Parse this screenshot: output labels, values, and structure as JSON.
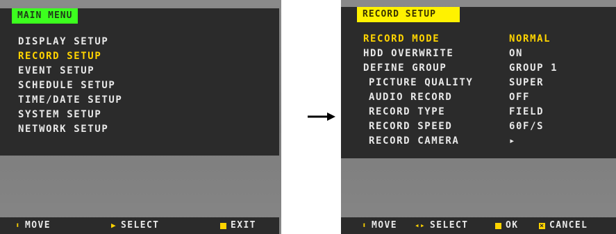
{
  "main_menu": {
    "title": "MAIN MENU",
    "items": [
      {
        "label": "DISPLAY SETUP",
        "active": false
      },
      {
        "label": "RECORD SETUP",
        "active": true
      },
      {
        "label": "EVENT SETUP",
        "active": false
      },
      {
        "label": "SCHEDULE SETUP",
        "active": false
      },
      {
        "label": "TIME/DATE SETUP",
        "active": false
      },
      {
        "label": "SYSTEM SETUP",
        "active": false
      },
      {
        "label": "NETWORK SETUP",
        "active": false
      }
    ],
    "footer": {
      "move": "MOVE",
      "select": "SELECT",
      "exit": "EXIT"
    }
  },
  "record_setup": {
    "title": "RECORD SETUP",
    "rows": [
      {
        "label": "RECORD MODE",
        "value": "NORMAL",
        "active": true
      },
      {
        "label": "HDD OVERWRITE",
        "value": "ON"
      },
      {
        "label": "DEFINE GROUP",
        "value": "GROUP 1"
      },
      {
        "label": "PICTURE QUALITY",
        "value": "SUPER"
      },
      {
        "label": "AUDIO RECORD",
        "value": "OFF"
      },
      {
        "label": "RECORD TYPE",
        "value": "FIELD"
      },
      {
        "label": "RECORD SPEED",
        "value": "60F/S"
      },
      {
        "label": "RECORD CAMERA",
        "value": "▸"
      }
    ],
    "footer": {
      "move": "MOVE",
      "select": "SELECT",
      "ok": "OK",
      "cancel": "CANCEL"
    }
  },
  "colors": {
    "menu_bg": "#2b2b2b",
    "main_title_bg": "#3cff1e",
    "record_title_bg": "#fff200",
    "highlight_text": "#ffd400",
    "normal_text": "#e8e8e8"
  },
  "icons": {
    "move": "up-down-arrow-icon",
    "select": "right-triangle-icon",
    "select_lr": "left-right-arrow-icon",
    "exit": "square-icon",
    "ok": "square-icon",
    "cancel": "x-square-icon",
    "flow": "right-arrow-icon"
  }
}
